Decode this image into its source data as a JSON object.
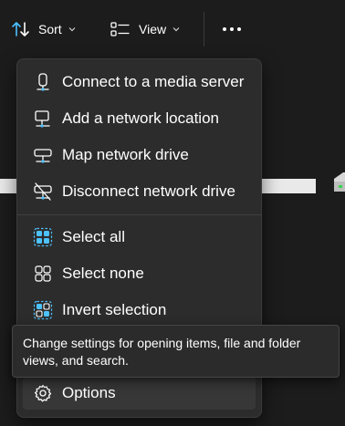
{
  "toolbar": {
    "sort_label": "Sort",
    "view_label": "View"
  },
  "menu": {
    "items": [
      {
        "label": "Connect to a media server",
        "icon": "media-server-icon"
      },
      {
        "label": "Add a network location",
        "icon": "network-location-icon"
      },
      {
        "label": "Map network drive",
        "icon": "map-drive-icon"
      },
      {
        "label": "Disconnect network drive",
        "icon": "disconnect-drive-icon"
      },
      {
        "label": "Select all",
        "icon": "select-all-icon"
      },
      {
        "label": "Select none",
        "icon": "select-none-icon"
      },
      {
        "label": "Invert selection",
        "icon": "invert-selection-icon"
      },
      {
        "label": "Options",
        "icon": "gear-icon"
      }
    ]
  },
  "tooltip": {
    "text": "Change settings for opening items, file and folder views, and search."
  },
  "colors": {
    "background": "#1c1c1c",
    "menu": "#2c2c2c",
    "accent": "#4cc2ff",
    "hover": "#373737"
  }
}
